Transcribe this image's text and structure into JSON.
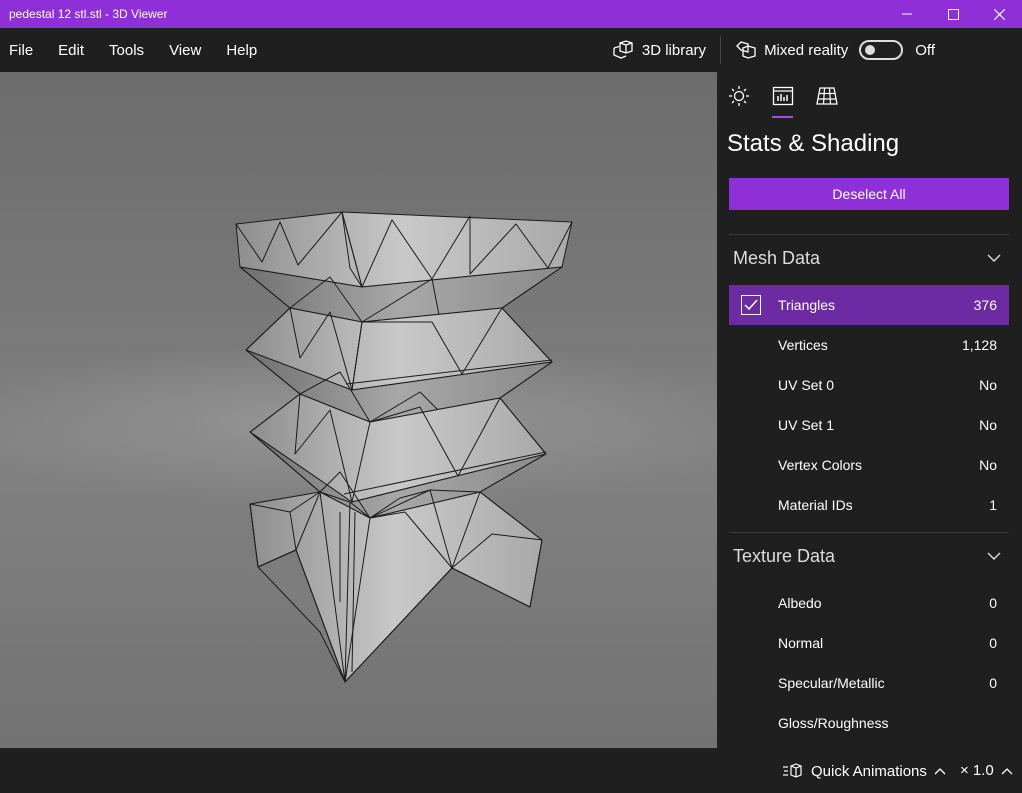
{
  "window": {
    "title": "pedestal 12 stl.stl - 3D Viewer"
  },
  "menu": {
    "items": [
      "File",
      "Edit",
      "Tools",
      "View",
      "Help"
    ],
    "library_label": "3D library",
    "mixed_reality_label": "Mixed reality",
    "mixed_reality_state": "Off"
  },
  "panel": {
    "tabs": [
      {
        "icon": "sun-icon",
        "active": false
      },
      {
        "icon": "stats-chart-icon",
        "active": true
      },
      {
        "icon": "grid-icon",
        "active": false
      }
    ],
    "title": "Stats & Shading",
    "deselect_label": "Deselect All",
    "mesh_section": {
      "title": "Mesh Data",
      "rows": [
        {
          "label": "Triangles",
          "value": "376",
          "checked": true
        },
        {
          "label": "Vertices",
          "value": "1,128"
        },
        {
          "label": "UV Set 0",
          "value": "No"
        },
        {
          "label": "UV Set 1",
          "value": "No"
        },
        {
          "label": "Vertex Colors",
          "value": "No"
        },
        {
          "label": "Material IDs",
          "value": "1"
        }
      ]
    },
    "texture_section": {
      "title": "Texture Data",
      "rows": [
        {
          "label": "Albedo",
          "value": "0"
        },
        {
          "label": "Normal",
          "value": "0"
        },
        {
          "label": "Specular/Metallic",
          "value": "0"
        },
        {
          "label": "Gloss/Roughness",
          "value": ""
        }
      ]
    }
  },
  "bottom": {
    "quick_animations_label": "Quick Animations",
    "speed_label": "× 1.0"
  },
  "colors": {
    "accent": "#8f2fd8",
    "selected_row": "#6c2aa3",
    "background": "#1f1f1f"
  }
}
